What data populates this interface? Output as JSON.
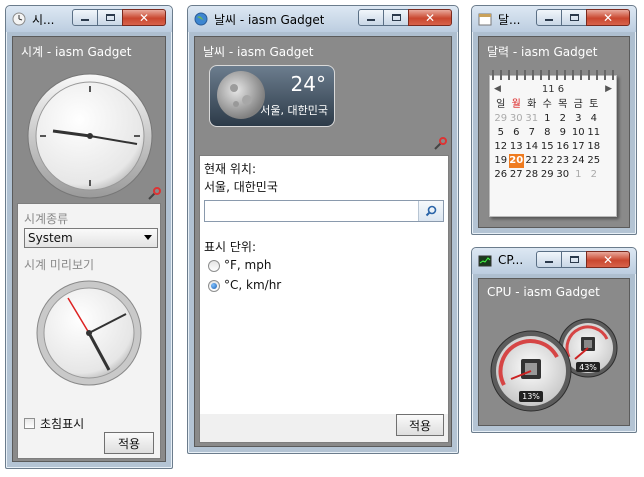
{
  "clock_window": {
    "title": "시...",
    "gadget_title": "시계 - iasm Gadget",
    "clock_type_label": "시계종류",
    "clock_type_value": "System",
    "preview_label": "시계 미리보기",
    "seconds_checkbox_label": "초침표시",
    "apply_label": "적용"
  },
  "weather_window": {
    "title": "날씨 - iasm Gadget",
    "gadget_title": "날씨 - iasm Gadget",
    "temperature": "24°",
    "location": "서울, 대한민국",
    "current_location_label": "현재 위치:",
    "current_location_value": "서울, 대한민국",
    "search_value": "",
    "unit_label": "표시 단위:",
    "unit_options": [
      "°F, mph",
      "°C, km/hr"
    ],
    "unit_selected": "°C, km/hr",
    "apply_label": "적용"
  },
  "calendar_window": {
    "title": "달...",
    "gadget_title": "달력 - iasm Gadget",
    "month_label": "11 6",
    "weekday_headers": [
      "일",
      "월",
      "화",
      "수",
      "목",
      "금",
      "토"
    ],
    "weeks": [
      [
        "29",
        "30",
        "31",
        "1",
        "2",
        "3",
        "4"
      ],
      [
        "5",
        "6",
        "7",
        "8",
        "9",
        "10",
        "11"
      ],
      [
        "12",
        "13",
        "14",
        "15",
        "16",
        "17",
        "18"
      ],
      [
        "19",
        "20",
        "21",
        "22",
        "23",
        "24",
        "25"
      ],
      [
        "26",
        "27",
        "28",
        "29",
        "30",
        "1",
        "2"
      ]
    ],
    "today": "20"
  },
  "cpu_window": {
    "title": "CP...",
    "gadget_title": "CPU - iasm Gadget",
    "cpu_percent": "13%",
    "memory_percent": "43%"
  },
  "colors": {
    "panel_gray": "#8a8a8a",
    "today_orange": "#ef7b1f",
    "close_red": "#c9472f"
  }
}
